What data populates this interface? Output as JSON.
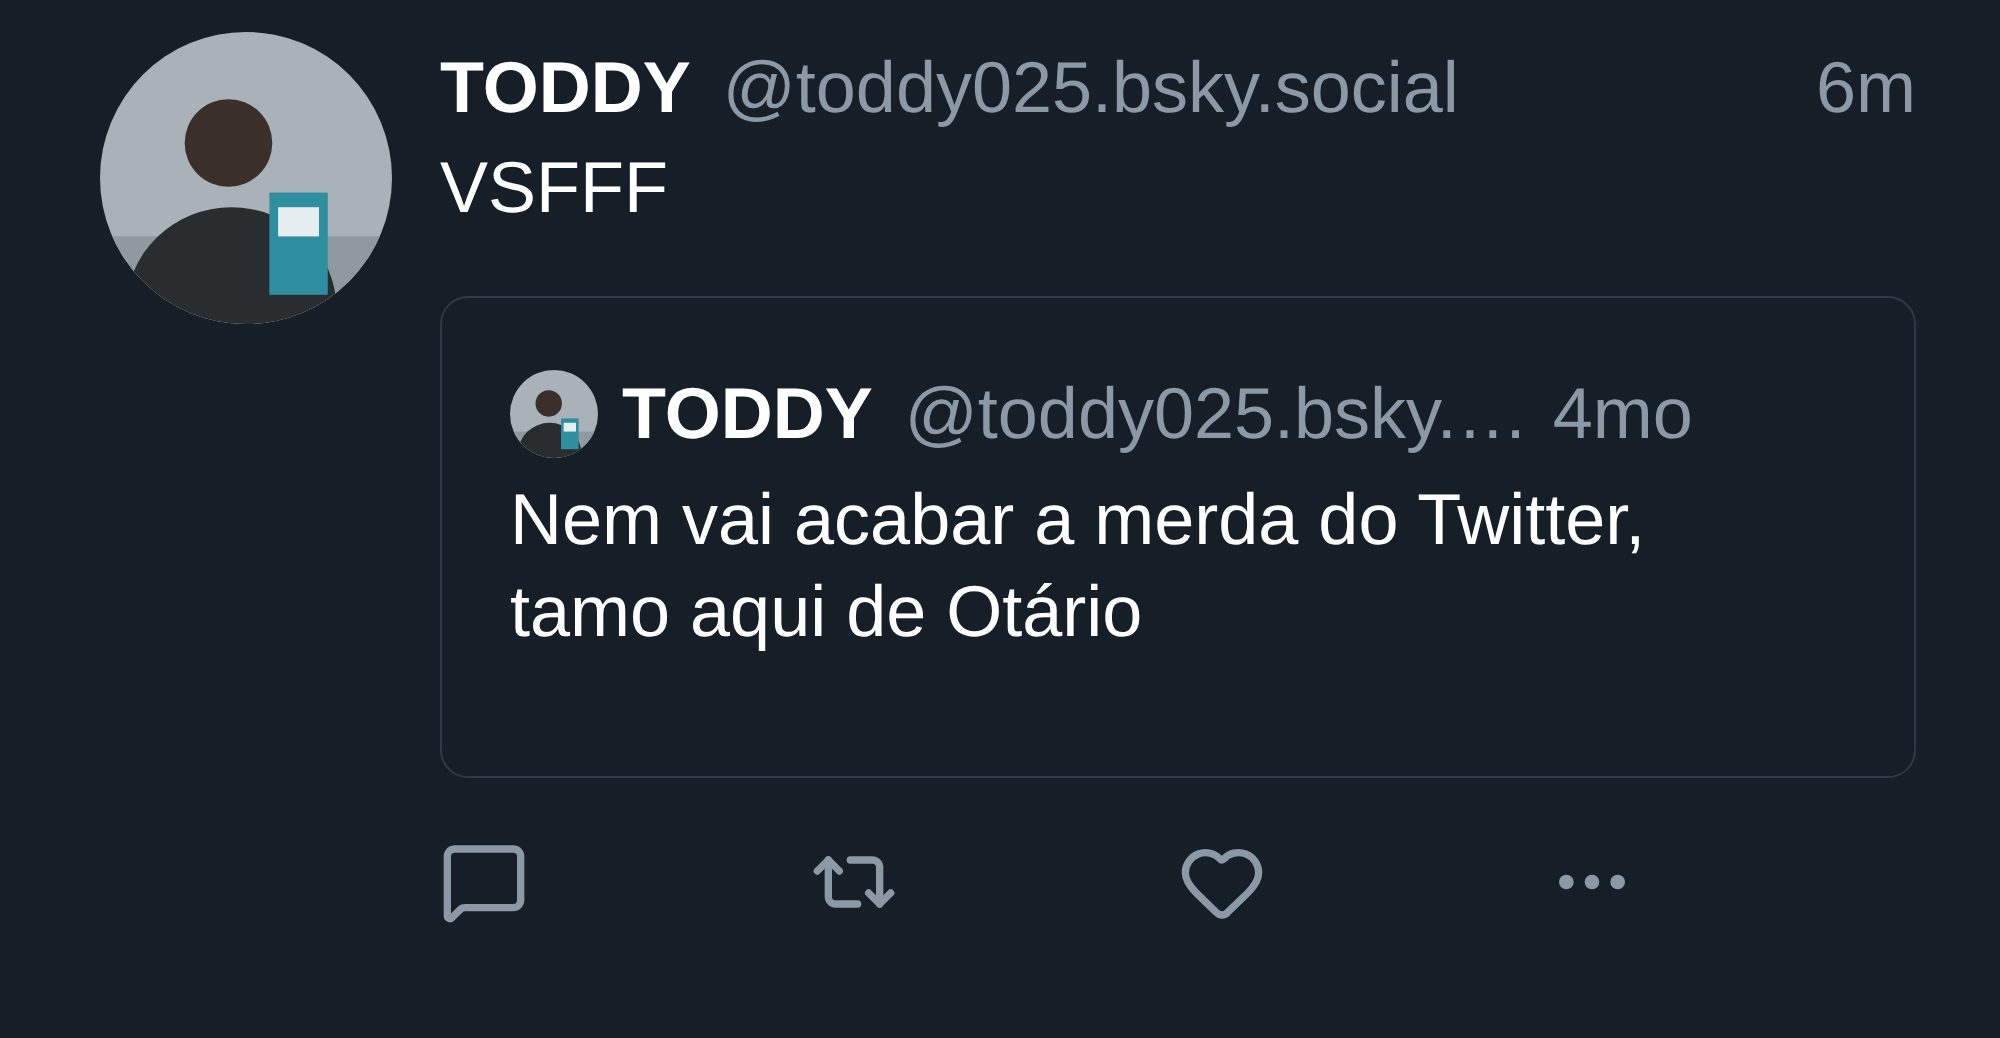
{
  "post": {
    "author": {
      "name": "TODDY",
      "handle": "@toddy025.bsky.social"
    },
    "time": "6m",
    "text": "VSFFF",
    "quote": {
      "author": {
        "name": "TODDY",
        "handle": "@toddy025.bsky.…"
      },
      "time": "4mo",
      "text": "Nem vai acabar a merda do Twitter, tamo aqui de Otário"
    },
    "actions": [
      {
        "kind": "reply"
      },
      {
        "kind": "repost"
      },
      {
        "kind": "like"
      },
      {
        "kind": "more"
      }
    ]
  }
}
